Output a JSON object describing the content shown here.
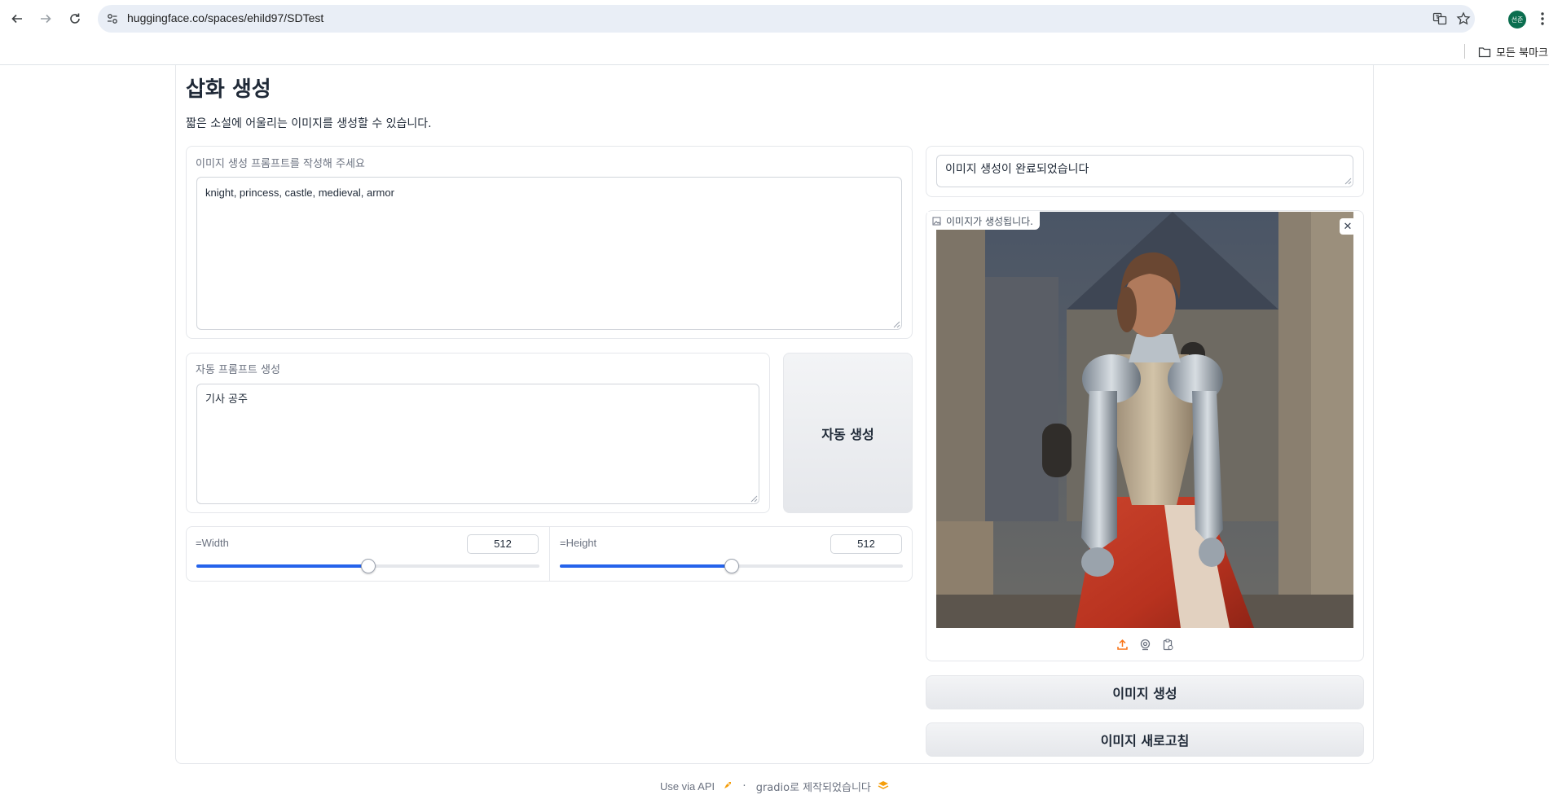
{
  "browser": {
    "url": "huggingface.co/spaces/ehild97/SDTest",
    "avatar_text": "선준",
    "bookmarks_folder": "모든 북마크"
  },
  "page": {
    "title": "삽화 생성",
    "description": "짧은 소설에 어울리는 이미지를 생성할 수 있습니다."
  },
  "prompt": {
    "label": "이미지 생성 프롬프트를 작성해 주세요",
    "value": "knight, princess, castle, medieval, armor"
  },
  "auto_prompt": {
    "label": "자동 프롬프트 생성",
    "value": "기사 공주",
    "button": "자동 생성"
  },
  "sliders": {
    "width": {
      "label": "=Width",
      "value": "512",
      "fraction": 0.5
    },
    "height": {
      "label": "=Height",
      "value": "512",
      "fraction": 0.5
    }
  },
  "status": {
    "value": "이미지 생성이 완료되었습니다"
  },
  "image": {
    "label": "이미지가 생성됩니다.",
    "icons": [
      "upload-icon",
      "webcam-icon",
      "clipboard-icon"
    ]
  },
  "buttons": {
    "generate": "이미지 생성",
    "refresh": "이미지 새로고침"
  },
  "footer": {
    "api": "Use via API",
    "separator": "·",
    "built_with": "gradio로 제작되었습니다"
  },
  "colors": {
    "accent": "#2563eb",
    "upload_icon": "#f97316"
  }
}
